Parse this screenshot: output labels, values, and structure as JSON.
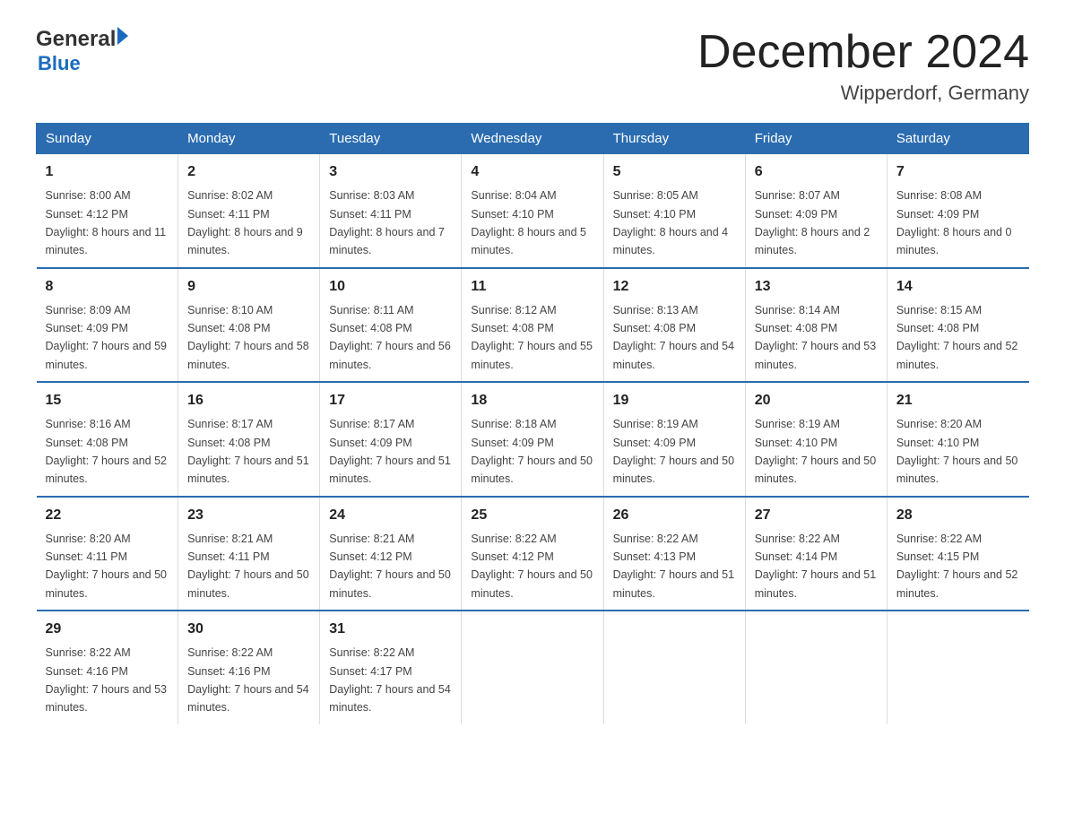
{
  "header": {
    "logo_general": "General",
    "logo_blue": "Blue",
    "month_title": "December 2024",
    "location": "Wipperdorf, Germany"
  },
  "columns": [
    "Sunday",
    "Monday",
    "Tuesday",
    "Wednesday",
    "Thursday",
    "Friday",
    "Saturday"
  ],
  "weeks": [
    [
      {
        "day": "1",
        "sunrise": "8:00 AM",
        "sunset": "4:12 PM",
        "daylight": "8 hours and 11 minutes."
      },
      {
        "day": "2",
        "sunrise": "8:02 AM",
        "sunset": "4:11 PM",
        "daylight": "8 hours and 9 minutes."
      },
      {
        "day": "3",
        "sunrise": "8:03 AM",
        "sunset": "4:11 PM",
        "daylight": "8 hours and 7 minutes."
      },
      {
        "day": "4",
        "sunrise": "8:04 AM",
        "sunset": "4:10 PM",
        "daylight": "8 hours and 5 minutes."
      },
      {
        "day": "5",
        "sunrise": "8:05 AM",
        "sunset": "4:10 PM",
        "daylight": "8 hours and 4 minutes."
      },
      {
        "day": "6",
        "sunrise": "8:07 AM",
        "sunset": "4:09 PM",
        "daylight": "8 hours and 2 minutes."
      },
      {
        "day": "7",
        "sunrise": "8:08 AM",
        "sunset": "4:09 PM",
        "daylight": "8 hours and 0 minutes."
      }
    ],
    [
      {
        "day": "8",
        "sunrise": "8:09 AM",
        "sunset": "4:09 PM",
        "daylight": "7 hours and 59 minutes."
      },
      {
        "day": "9",
        "sunrise": "8:10 AM",
        "sunset": "4:08 PM",
        "daylight": "7 hours and 58 minutes."
      },
      {
        "day": "10",
        "sunrise": "8:11 AM",
        "sunset": "4:08 PM",
        "daylight": "7 hours and 56 minutes."
      },
      {
        "day": "11",
        "sunrise": "8:12 AM",
        "sunset": "4:08 PM",
        "daylight": "7 hours and 55 minutes."
      },
      {
        "day": "12",
        "sunrise": "8:13 AM",
        "sunset": "4:08 PM",
        "daylight": "7 hours and 54 minutes."
      },
      {
        "day": "13",
        "sunrise": "8:14 AM",
        "sunset": "4:08 PM",
        "daylight": "7 hours and 53 minutes."
      },
      {
        "day": "14",
        "sunrise": "8:15 AM",
        "sunset": "4:08 PM",
        "daylight": "7 hours and 52 minutes."
      }
    ],
    [
      {
        "day": "15",
        "sunrise": "8:16 AM",
        "sunset": "4:08 PM",
        "daylight": "7 hours and 52 minutes."
      },
      {
        "day": "16",
        "sunrise": "8:17 AM",
        "sunset": "4:08 PM",
        "daylight": "7 hours and 51 minutes."
      },
      {
        "day": "17",
        "sunrise": "8:17 AM",
        "sunset": "4:09 PM",
        "daylight": "7 hours and 51 minutes."
      },
      {
        "day": "18",
        "sunrise": "8:18 AM",
        "sunset": "4:09 PM",
        "daylight": "7 hours and 50 minutes."
      },
      {
        "day": "19",
        "sunrise": "8:19 AM",
        "sunset": "4:09 PM",
        "daylight": "7 hours and 50 minutes."
      },
      {
        "day": "20",
        "sunrise": "8:19 AM",
        "sunset": "4:10 PM",
        "daylight": "7 hours and 50 minutes."
      },
      {
        "day": "21",
        "sunrise": "8:20 AM",
        "sunset": "4:10 PM",
        "daylight": "7 hours and 50 minutes."
      }
    ],
    [
      {
        "day": "22",
        "sunrise": "8:20 AM",
        "sunset": "4:11 PM",
        "daylight": "7 hours and 50 minutes."
      },
      {
        "day": "23",
        "sunrise": "8:21 AM",
        "sunset": "4:11 PM",
        "daylight": "7 hours and 50 minutes."
      },
      {
        "day": "24",
        "sunrise": "8:21 AM",
        "sunset": "4:12 PM",
        "daylight": "7 hours and 50 minutes."
      },
      {
        "day": "25",
        "sunrise": "8:22 AM",
        "sunset": "4:12 PM",
        "daylight": "7 hours and 50 minutes."
      },
      {
        "day": "26",
        "sunrise": "8:22 AM",
        "sunset": "4:13 PM",
        "daylight": "7 hours and 51 minutes."
      },
      {
        "day": "27",
        "sunrise": "8:22 AM",
        "sunset": "4:14 PM",
        "daylight": "7 hours and 51 minutes."
      },
      {
        "day": "28",
        "sunrise": "8:22 AM",
        "sunset": "4:15 PM",
        "daylight": "7 hours and 52 minutes."
      }
    ],
    [
      {
        "day": "29",
        "sunrise": "8:22 AM",
        "sunset": "4:16 PM",
        "daylight": "7 hours and 53 minutes."
      },
      {
        "day": "30",
        "sunrise": "8:22 AM",
        "sunset": "4:16 PM",
        "daylight": "7 hours and 54 minutes."
      },
      {
        "day": "31",
        "sunrise": "8:22 AM",
        "sunset": "4:17 PM",
        "daylight": "7 hours and 54 minutes."
      },
      null,
      null,
      null,
      null
    ]
  ]
}
